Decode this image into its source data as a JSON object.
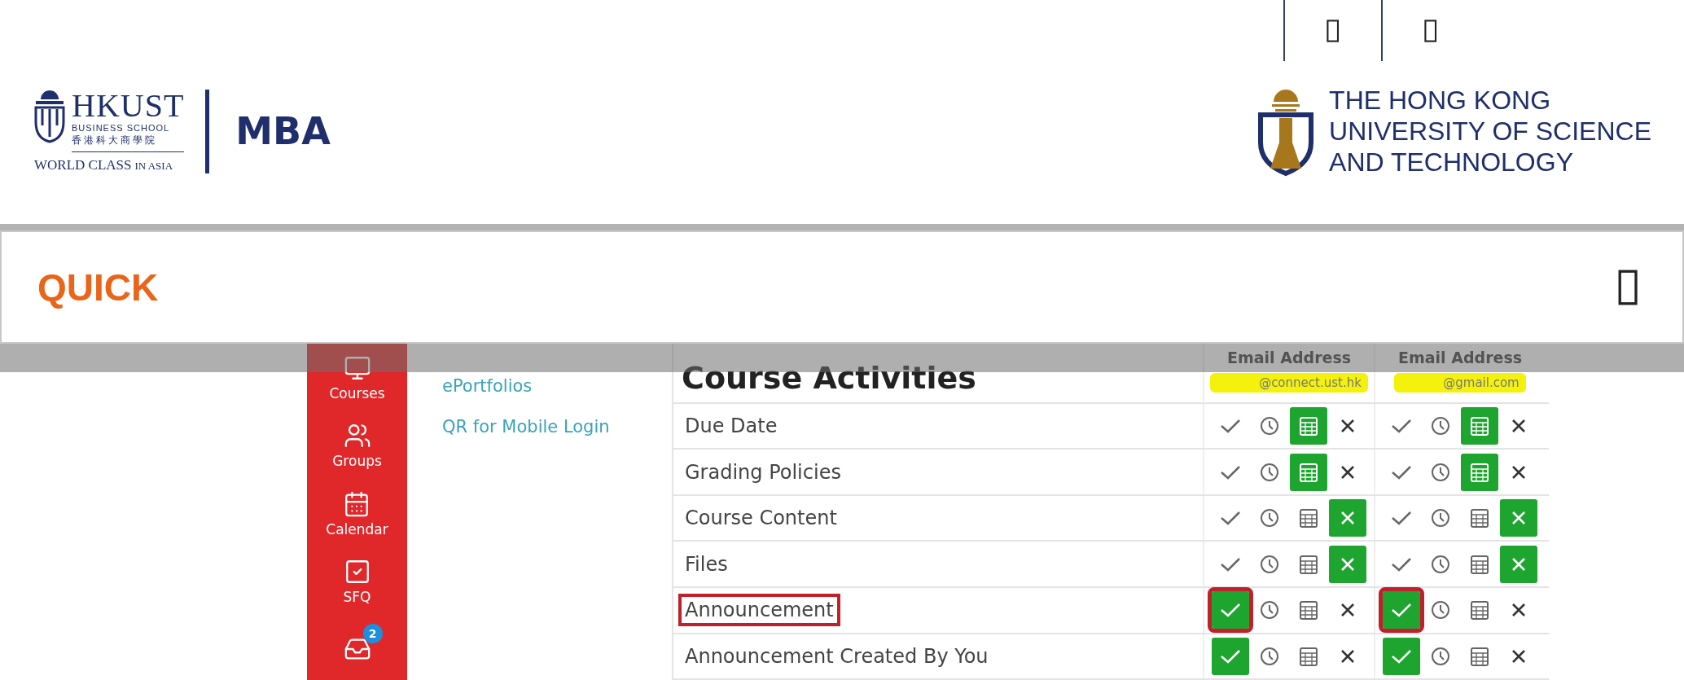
{
  "header": {
    "top_icons": [
      {
        "kind": "glyph"
      },
      {
        "kind": "glyph"
      }
    ],
    "school_logo": {
      "name": "HKUST",
      "subtitle": "BUSINESS SCHOOL",
      "chinese": "香港科大商學院",
      "tagline_main": "WORLD CLASS",
      "tagline_small": "IN ASIA"
    },
    "program": "MBA",
    "university_logo": {
      "lines": [
        "THE HONG KONG",
        "UNIVERSITY OF SCIENCE",
        "AND TECHNOLOGY"
      ]
    }
  },
  "quick_bar": {
    "title": "QUICK",
    "kind": "glyph"
  },
  "screenshot": {
    "sidebar": [
      {
        "kind": "courses",
        "label": "Courses"
      },
      {
        "kind": "groups",
        "label": "Groups"
      },
      {
        "kind": "calendar",
        "label": "Calendar"
      },
      {
        "kind": "sfq",
        "label": "SFQ"
      },
      {
        "kind": "inbox",
        "badge": "2"
      }
    ],
    "links": [
      "ePortfolios",
      "QR for Mobile Login"
    ],
    "table": {
      "title": "Course Activities",
      "columns": [
        {
          "heading": "Email Address",
          "email": "@connect.ust.hk"
        },
        {
          "heading": "Email Address",
          "email": "@gmail.com"
        }
      ],
      "rows": [
        {
          "label": "Due Date",
          "highlighted": false,
          "cells": [
            {
              "options": [
                {
                  "kind": "check",
                  "selected": false
                },
                {
                  "kind": "clock",
                  "selected": false
                },
                {
                  "kind": "calendar",
                  "selected": true
                },
                {
                  "kind": "never",
                  "selected": false
                }
              ]
            },
            {
              "options": [
                {
                  "kind": "check",
                  "selected": false
                },
                {
                  "kind": "clock",
                  "selected": false
                },
                {
                  "kind": "calendar",
                  "selected": true
                },
                {
                  "kind": "never",
                  "selected": false
                }
              ]
            }
          ]
        },
        {
          "label": "Grading Policies",
          "highlighted": false,
          "cells": [
            {
              "options": [
                {
                  "kind": "check",
                  "selected": false
                },
                {
                  "kind": "clock",
                  "selected": false
                },
                {
                  "kind": "calendar",
                  "selected": true
                },
                {
                  "kind": "never",
                  "selected": false
                }
              ]
            },
            {
              "options": [
                {
                  "kind": "check",
                  "selected": false
                },
                {
                  "kind": "clock",
                  "selected": false
                },
                {
                  "kind": "calendar",
                  "selected": true
                },
                {
                  "kind": "never",
                  "selected": false
                }
              ]
            }
          ]
        },
        {
          "label": "Course Content",
          "highlighted": false,
          "cells": [
            {
              "options": [
                {
                  "kind": "check",
                  "selected": false
                },
                {
                  "kind": "clock",
                  "selected": false
                },
                {
                  "kind": "calendar",
                  "selected": false
                },
                {
                  "kind": "never",
                  "selected": true
                }
              ]
            },
            {
              "options": [
                {
                  "kind": "check",
                  "selected": false
                },
                {
                  "kind": "clock",
                  "selected": false
                },
                {
                  "kind": "calendar",
                  "selected": false
                },
                {
                  "kind": "never",
                  "selected": true
                }
              ]
            }
          ]
        },
        {
          "label": "Files",
          "highlighted": false,
          "cells": [
            {
              "options": [
                {
                  "kind": "check",
                  "selected": false
                },
                {
                  "kind": "clock",
                  "selected": false
                },
                {
                  "kind": "calendar",
                  "selected": false
                },
                {
                  "kind": "never",
                  "selected": true
                }
              ]
            },
            {
              "options": [
                {
                  "kind": "check",
                  "selected": false
                },
                {
                  "kind": "clock",
                  "selected": false
                },
                {
                  "kind": "calendar",
                  "selected": false
                },
                {
                  "kind": "never",
                  "selected": true
                }
              ]
            }
          ]
        },
        {
          "label": "Announcement",
          "highlighted": true,
          "cells": [
            {
              "options": [
                {
                  "kind": "check",
                  "selected": true
                },
                {
                  "kind": "clock",
                  "selected": false
                },
                {
                  "kind": "calendar",
                  "selected": false
                },
                {
                  "kind": "never",
                  "selected": false
                }
              ]
            },
            {
              "options": [
                {
                  "kind": "check",
                  "selected": true
                },
                {
                  "kind": "clock",
                  "selected": false
                },
                {
                  "kind": "calendar",
                  "selected": false
                },
                {
                  "kind": "never",
                  "selected": false
                }
              ]
            }
          ]
        },
        {
          "label": "Announcement Created By You",
          "highlighted": false,
          "cells": [
            {
              "options": [
                {
                  "kind": "check",
                  "selected": true
                },
                {
                  "kind": "clock",
                  "selected": false
                },
                {
                  "kind": "calendar",
                  "selected": false
                },
                {
                  "kind": "never",
                  "selected": false
                }
              ]
            },
            {
              "options": [
                {
                  "kind": "check",
                  "selected": true
                },
                {
                  "kind": "clock",
                  "selected": false
                },
                {
                  "kind": "calendar",
                  "selected": false
                },
                {
                  "kind": "never",
                  "selected": false
                }
              ]
            }
          ]
        }
      ]
    }
  }
}
